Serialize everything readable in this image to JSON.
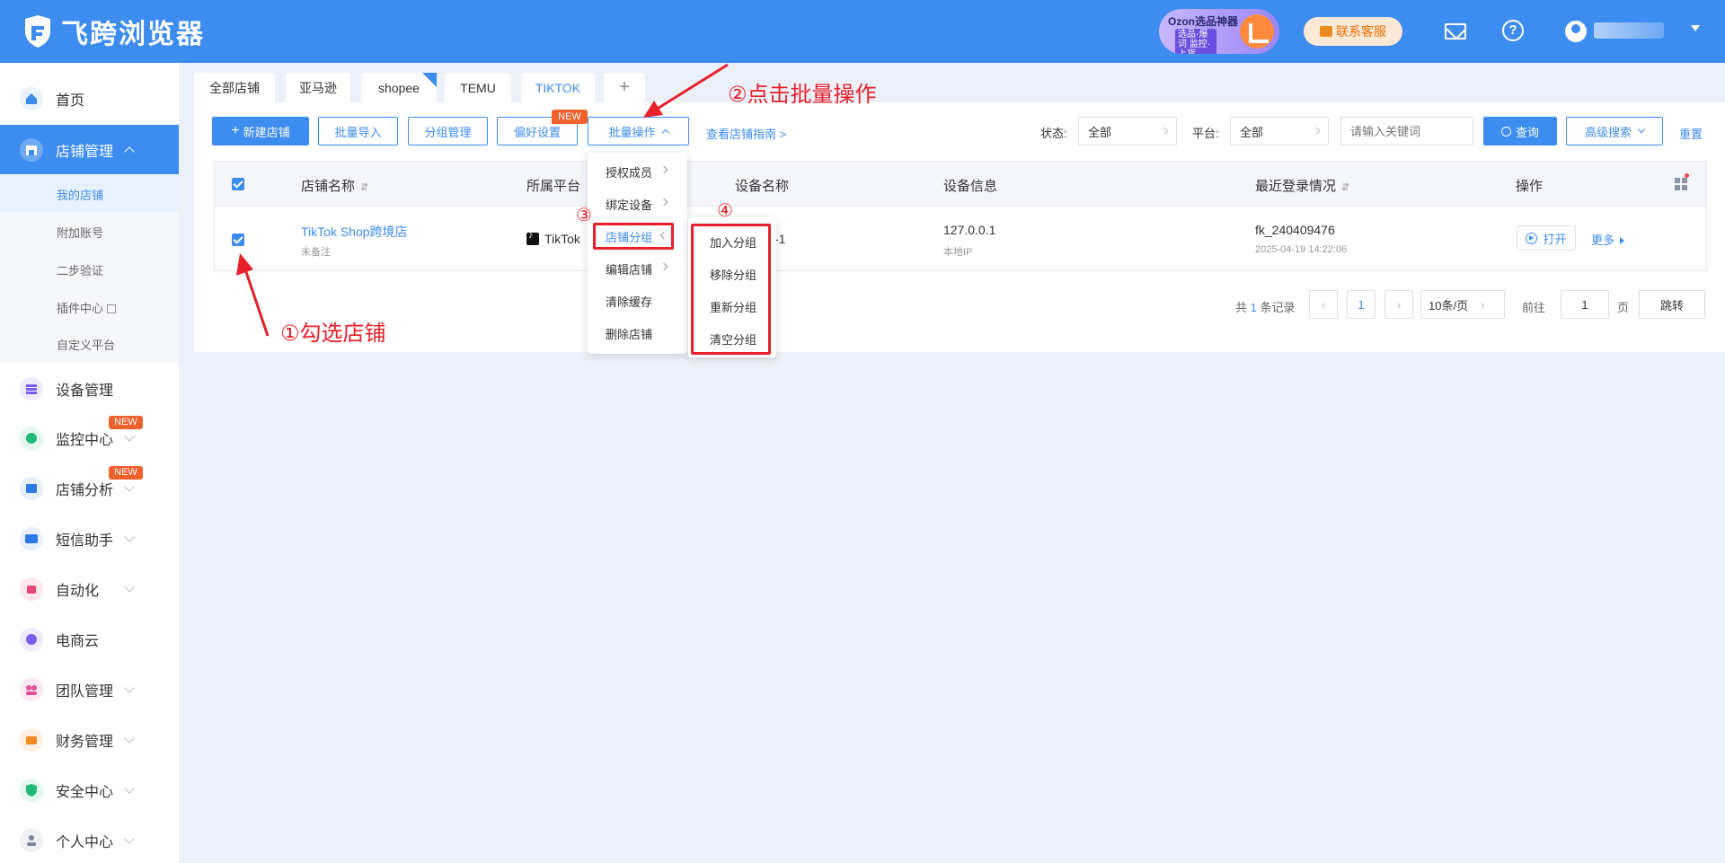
{
  "header": {
    "app_name": "飞跨浏览器",
    "promo_title": "Ozon选品神器",
    "promo_sub": "选品·爆词 监控·上货",
    "service_label": "联系客服",
    "user_name": "▪ ▪▪▪▪▪ ▪"
  },
  "sidebar": {
    "items": [
      {
        "label": "首页",
        "icon": "home-icon"
      },
      {
        "label": "店铺管理",
        "icon": "store-icon"
      },
      {
        "label": "设备管理",
        "icon": "device-icon"
      },
      {
        "label": "监控中心",
        "icon": "monitor-icon",
        "badge": "NEW"
      },
      {
        "label": "店铺分析",
        "icon": "analysis-icon",
        "badge": "NEW"
      },
      {
        "label": "短信助手",
        "icon": "sms-icon"
      },
      {
        "label": "自动化",
        "icon": "robot-icon"
      },
      {
        "label": "电商云",
        "icon": "cloud-icon"
      },
      {
        "label": "团队管理",
        "icon": "team-icon"
      },
      {
        "label": "财务管理",
        "icon": "wallet-icon"
      },
      {
        "label": "安全中心",
        "icon": "shield-icon"
      },
      {
        "label": "个人中心",
        "icon": "user-icon"
      }
    ],
    "sub_items": [
      "我的店铺",
      "附加账号",
      "二步验证",
      "插件中心",
      "自定义平台"
    ]
  },
  "tabs": [
    "全部店铺",
    "亚马逊",
    "shopee",
    "TEMU",
    "TIKTOK",
    "+"
  ],
  "toolbar": {
    "new_store": "新建店铺",
    "batch_import": "批量导入",
    "group_manage": "分组管理",
    "preferences": "偏好设置",
    "preferences_badge": "NEW",
    "batch_ops": "批量操作",
    "guide_link": "查看店铺指南 >",
    "status_label": "状态:",
    "status_value": "全部",
    "platform_label": "平台:",
    "platform_value": "全部",
    "keyword_placeholder": "请输入关键词",
    "query": "查询",
    "advanced_search": "高级搜索",
    "reset": "重置"
  },
  "table": {
    "columns": [
      "店铺名称",
      "所属平台",
      "设备名称",
      "设备信息",
      "最近登录情况",
      "操作"
    ],
    "rows": [
      {
        "store_name": "TikTok Shop跨境店",
        "note": "未备注",
        "platform": "TikTok",
        "device_name": "-1",
        "device_ip": "127.0.0.1",
        "device_type": "本地IP",
        "last_login_user": "fk_240409476",
        "last_login_time": "2025-04-19 14:22:06",
        "open": "打开",
        "more": "更多"
      }
    ]
  },
  "pagination": {
    "total_prefix": "共",
    "total": "1",
    "total_suffix": "条记录",
    "current_page": "1",
    "page_size": "10条/页",
    "goto_label": "前往",
    "goto_value": "1",
    "page_suffix": "页",
    "jump": "跳转"
  },
  "batch_menu": [
    "授权成员",
    "绑定设备",
    "店铺分组",
    "编辑店铺",
    "清除缓存",
    "删除店铺"
  ],
  "group_submenu": [
    "加入分组",
    "移除分组",
    "重新分组",
    "清空分组"
  ],
  "annotations": {
    "step1": "①勾选店铺",
    "step2": "②点击批量操作",
    "step3": "③",
    "step4": "④"
  },
  "colors": {
    "brand": "#3d8cf0",
    "annotation": "#e8202a",
    "badge": "#f0612c"
  }
}
